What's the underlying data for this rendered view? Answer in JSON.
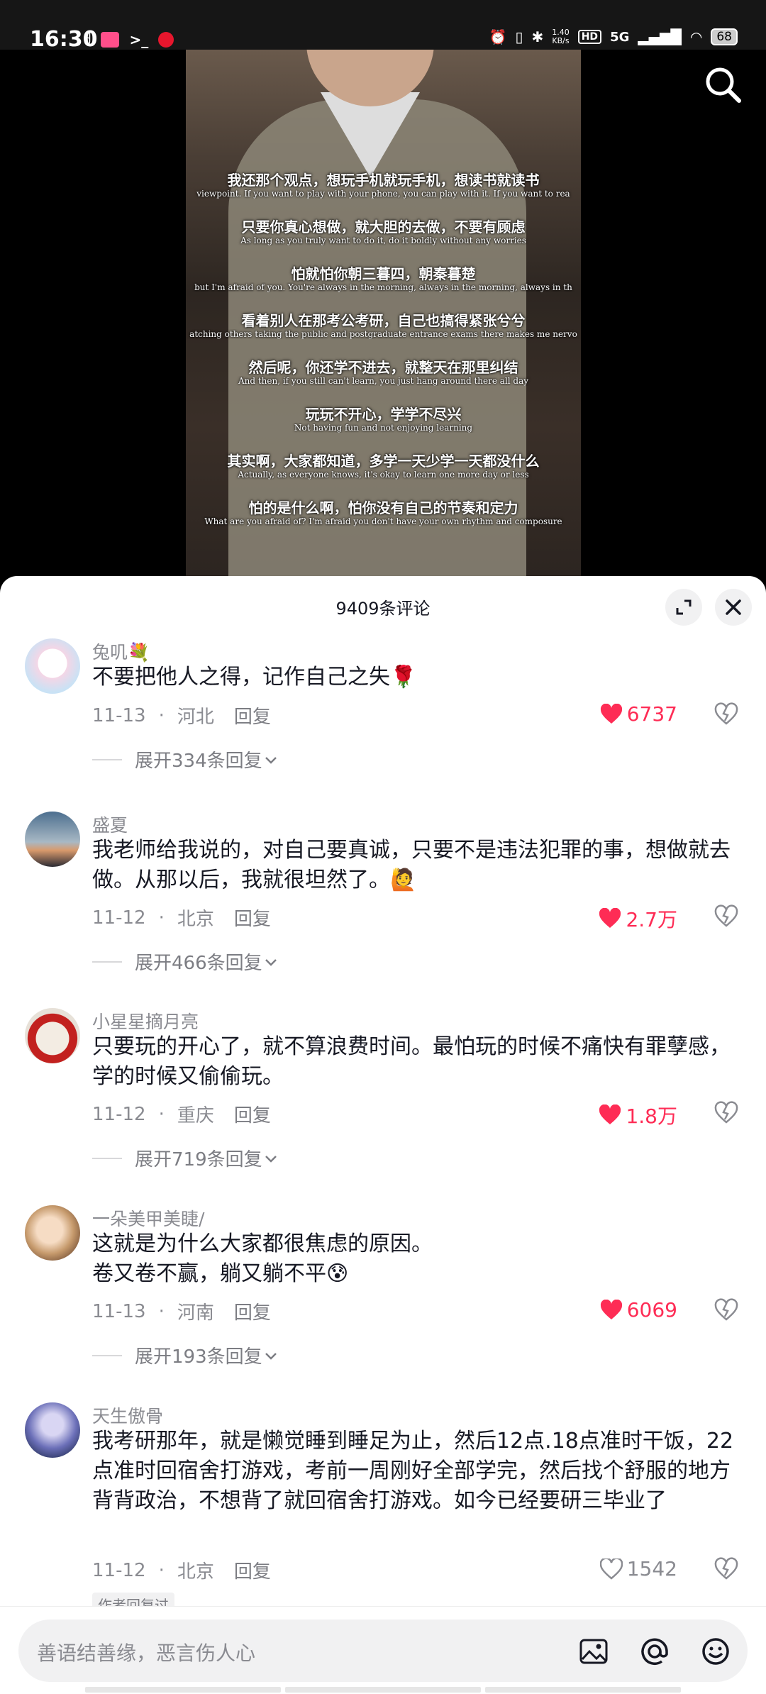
{
  "status_bar": {
    "time": "16:30",
    "net_speed_value": "1.40",
    "net_speed_unit": "KB/s",
    "hd_label": "HD",
    "network": "5G",
    "battery": "68"
  },
  "video": {
    "subtitles": [
      {
        "zh": "我还那个观点，想玩手机就玩手机，想读书就读书",
        "en": "viewpoint. If you want to play with your phone, you can play with it. If you want to rea"
      },
      {
        "zh": "只要你真心想做，就大胆的去做，不要有顾虑",
        "en": "As long as you truly want to do it, do it boldly without any worries"
      },
      {
        "zh": "怕就怕你朝三暮四，朝秦暮楚",
        "en": "but I'm afraid of you. You're always in the morning, always in the morning, always in th"
      },
      {
        "zh": "看着别人在那考公考研，自己也搞得紧张兮兮",
        "en": "atching others taking the public and postgraduate entrance exams there makes me nervo"
      },
      {
        "zh": "然后呢，你还学不进去，就整天在那里纠结",
        "en": "And then, if you still can't learn, you just hang around there all day"
      },
      {
        "zh": "玩玩不开心，学学不尽兴",
        "en": "Not having fun and not enjoying learning"
      },
      {
        "zh": "其实啊，大家都知道，多学一天少学一天都没什么",
        "en": "Actually, as everyone knows, it's okay to learn one more day or less"
      },
      {
        "zh": "怕的是什么啊，怕你没有自己的节奏和定力",
        "en": "What are you afraid of? I'm afraid you don't have your own rhythm and composure"
      }
    ]
  },
  "comments_panel": {
    "title": "9409条评论",
    "comments": [
      {
        "user": "兔叽💐",
        "text": "不要把他人之得，记作自己之失🌹",
        "date": "11-13",
        "location": "河北",
        "reply": "回复",
        "likes": "6737",
        "expand": "展开334条回复"
      },
      {
        "user": "盛夏",
        "text": "我老师给我说的，对自己要真诚，只要不是违法犯罪的事，想做就去做。从那以后，我就很坦然了。🙋",
        "date": "11-12",
        "location": "北京",
        "reply": "回复",
        "likes": "2.7万",
        "expand": "展开466条回复"
      },
      {
        "user": "小星星摘月亮",
        "text": "只要玩的开心了，就不算浪费时间。最怕玩的时候不痛快有罪孽感，学的时候又偷偷玩。",
        "date": "11-12",
        "location": "重庆",
        "reply": "回复",
        "likes": "1.8万",
        "expand": "展开719条回复"
      },
      {
        "user": "一朵美甲美睫/",
        "text_line1": "这就是为什么大家都很焦虑的原因。",
        "text_line2": "卷又卷不赢，躺又躺不平😰",
        "date": "11-13",
        "location": "河南",
        "reply": "回复",
        "likes": "6069",
        "expand": "展开193条回复"
      },
      {
        "user": "天生傲骨",
        "text": "我考研那年，就是懒觉睡到睡足为止，然后12点.18点准时干饭，22点准时回宿舍打游戏，考前一周刚好全部学完，然后找个舒服的地方背背政治，不想背了就回宿舍打游戏。如今已经要研三毕业了",
        "date": "11-12",
        "location": "北京",
        "reply": "回复",
        "likes": "1542",
        "author_tag": "作者回复过"
      }
    ]
  },
  "input": {
    "placeholder": "善语结善缘，恶言伤人心"
  },
  "icons": {
    "search": "search-icon",
    "expand": "expand-icon",
    "close": "close-icon",
    "heart": "heart-icon",
    "dislike": "dislike-heart-icon",
    "image": "image-icon",
    "mention": "at-icon",
    "emoji": "emoji-icon"
  },
  "colors": {
    "like_red": "#fe2c55",
    "muted": "#8a8b91"
  }
}
